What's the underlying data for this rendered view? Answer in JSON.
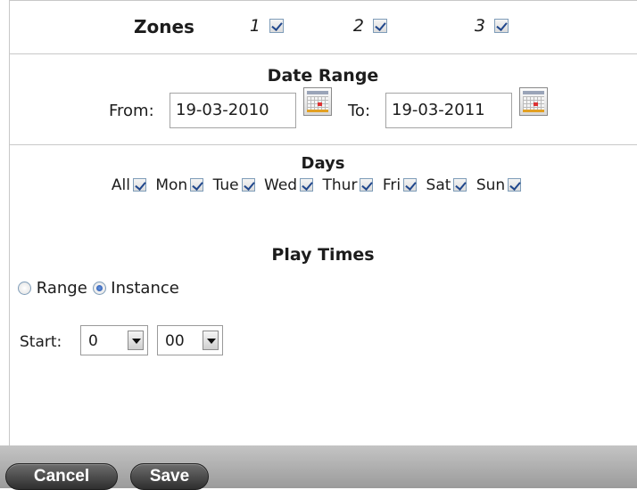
{
  "zones": {
    "label": "Zones",
    "items": [
      {
        "number": "1",
        "checked": true
      },
      {
        "number": "2",
        "checked": true
      },
      {
        "number": "3",
        "checked": true
      }
    ]
  },
  "date_range": {
    "title": "Date Range",
    "from_label": "From:",
    "from_value": "19-03-2010",
    "to_label": "To:",
    "to_value": "19-03-2011",
    "calendar_icon": "calendar-icon"
  },
  "days": {
    "title": "Days",
    "items": [
      {
        "label": "All",
        "checked": true
      },
      {
        "label": "Mon",
        "checked": true
      },
      {
        "label": "Tue",
        "checked": true
      },
      {
        "label": "Wed",
        "checked": true
      },
      {
        "label": "Thur",
        "checked": true
      },
      {
        "label": "Fri",
        "checked": true
      },
      {
        "label": "Sat",
        "checked": true
      },
      {
        "label": "Sun",
        "checked": true
      }
    ]
  },
  "play_times": {
    "title": "Play Times",
    "range_label": "Range",
    "instance_label": "Instance",
    "selected": "Instance",
    "start_label": "Start:",
    "hour_value": "0",
    "minute_value": "00"
  },
  "footer": {
    "cancel_label": "Cancel",
    "save_label": "Save"
  },
  "colors": {
    "footer_bar": "#aaaaaa",
    "button": "#3f3f3f",
    "check": "#21478c"
  }
}
